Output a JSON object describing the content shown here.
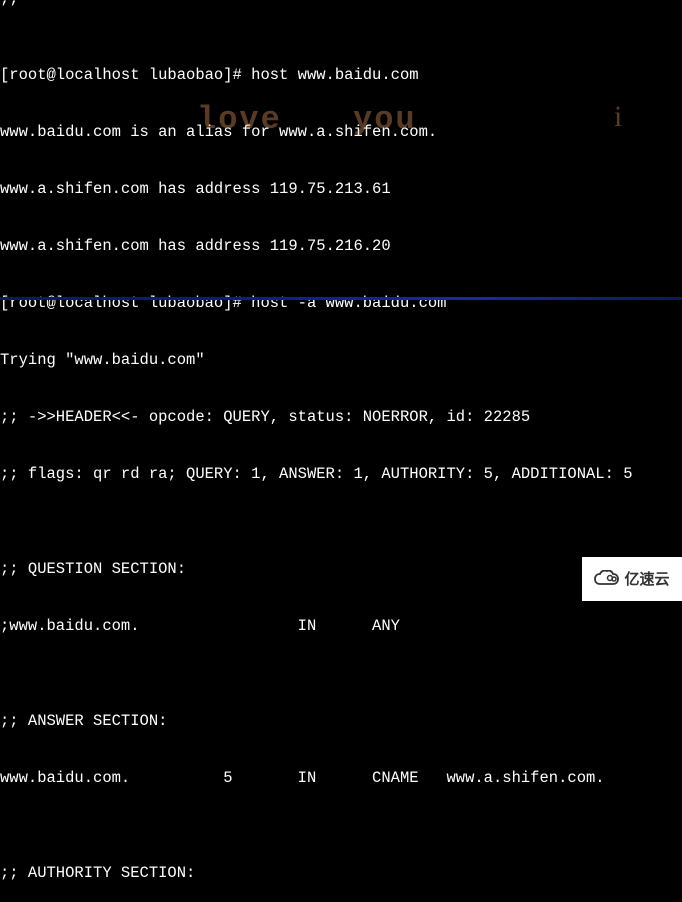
{
  "terminal": {
    "lines": [
      "[root@localhost lubaobao]# host www.baidu.com",
      "www.baidu.com is an alias for www.a.shifen.com.",
      "www.a.shifen.com has address 119.75.213.61",
      "www.a.shifen.com has address 119.75.216.20",
      "[root@localhost lubaobao]# host -a www.baidu.com",
      "Trying \"www.baidu.com\"",
      ";; ->>HEADER<<- opcode: QUERY, status: NOERROR, id: 22285",
      ";; flags: qr rd ra; QUERY: 1, ANSWER: 1, AUTHORITY: 5, ADDITIONAL: 5",
      "",
      ";; QUESTION SECTION:",
      ";www.baidu.com.                 IN      ANY",
      "",
      ";; ANSWER SECTION:",
      "www.baidu.com.          5       IN      CNAME   www.a.shifen.com.",
      "",
      ";; AUTHORITY SECTION:"
    ],
    "partial_top": ";;  * * *"
  },
  "watermark": {
    "love": "love",
    "you": "you",
    "i": "i"
  },
  "logo": {
    "text": "亿速云"
  }
}
